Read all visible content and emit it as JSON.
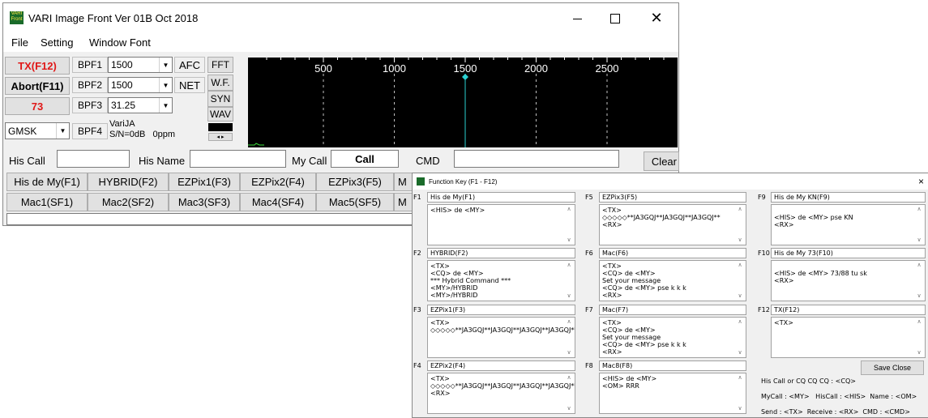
{
  "main": {
    "title": "VARI Image Front Ver 01B Oct 2018",
    "logo_text": "VARI Front",
    "menu": [
      "File",
      "Setting",
      "Window Font"
    ],
    "buttons": {
      "tx": "TX(F12)",
      "abort": "Abort(F11)",
      "seventythree": "73"
    },
    "mode_select": "GMSK",
    "bpf": [
      {
        "label": "BPF1",
        "value": "1500"
      },
      {
        "label": "BPF2",
        "value": "1500"
      },
      {
        "label": "BPF3",
        "value": "31.25"
      },
      {
        "label": "BPF4",
        "value": "VariJA"
      }
    ],
    "sn_text": "S/N=0dB   0ppm",
    "afc": "AFC",
    "net": "NET",
    "view_buttons": [
      "FFT",
      "W.F.",
      "SYN",
      "WAV"
    ],
    "spectrum": {
      "ticks": [
        "500",
        "1000",
        "1500",
        "2000",
        "2500"
      ],
      "marker_value": 1500,
      "background": "#000000",
      "marker_color": "#2ad0d0"
    },
    "fields": {
      "his_call_label": "His Call",
      "his_name_label": "His Name",
      "my_call_label": "My Call",
      "my_call_value": "Call",
      "cmd_label": "CMD",
      "clear": "Clear"
    },
    "fkey_row": [
      "His de My(F1)",
      "HYBRID(F2)",
      "EZPix1(F3)",
      "EZPix2(F4)",
      "EZPix3(F5)",
      "M"
    ],
    "mac_row": [
      "Mac1(SF1)",
      "Mac2(SF2)",
      "Mac3(SF3)",
      "Mac4(SF4)",
      "Mac5(SF5)",
      "M"
    ]
  },
  "dialog": {
    "title": "Function Key (F1 - F12)",
    "close": "×",
    "keys": [
      {
        "label": "F1",
        "name": "His de My(F1)",
        "text": "<HIS> de <MY>"
      },
      {
        "label": "F2",
        "name": "HYBRID(F2)",
        "text": "<TX>\n<CQ> de <MY>\n*** Hybrid Command ***\n<MY>/HYBRID\n<MY>/HYBRID"
      },
      {
        "label": "F3",
        "name": "EZPix1(F3)",
        "text": "<TX>\n◇◇◇◇◇**JA3GQJ**JA3GQJ**JA3GQJ**JA3GQJ**JA3GQJ**JA3GQJ**JA3GQJ**JA3GQJ**JA3GQJ**JA3GQJ**JA3GQJ**JA3GQJ**"
      },
      {
        "label": "F4",
        "name": "EZPix2(F4)",
        "text": "<TX>\n◇◇◇◇◇**JA3GQJ**JA3GQJ**JA3GQJ**JA3GQJ**JA3GQJ**JA3GQJ**\n<RX>"
      },
      {
        "label": "F5",
        "name": "EZPix3(F5)",
        "text": "<TX>\n◇◇◇◇◇**JA3GQJ**JA3GQJ**JA3GQJ**\n<RX>"
      },
      {
        "label": "F6",
        "name": "Mac(F6)",
        "text": "<TX>\n<CQ> de <MY>\nSet your message\n<CQ> de <MY> pse k k k\n<RX>"
      },
      {
        "label": "F7",
        "name": "Mac(F7)",
        "text": "<TX>\n<CQ> de <MY>\nSet your message\n<CQ> de <MY> pse k k k\n<RX>"
      },
      {
        "label": "F8",
        "name": "Mac8(F8)",
        "text": "<HIS> de <MY>\n<OM> RRR"
      },
      {
        "label": "F9",
        "name": "His de My KN(F9)",
        "text": "\n<HIS> de <MY> pse KN\n<RX>"
      },
      {
        "label": "F10",
        "name": "His de My 73(F10)",
        "text": "\n<HIS> de <MY> 73/88 tu sk\n<RX>"
      },
      {
        "label": "F12",
        "name": "TX(F12)",
        "text": "<TX>"
      }
    ],
    "save_close": "Save Close",
    "help": [
      "His Call or CQ CQ CQ : <CQ>",
      "MyCall : <MY>   HisCall : <HIS>  Name : <OM>",
      "Send : <TX>  Receive : <RX>  CMD : <CMD>"
    ]
  }
}
